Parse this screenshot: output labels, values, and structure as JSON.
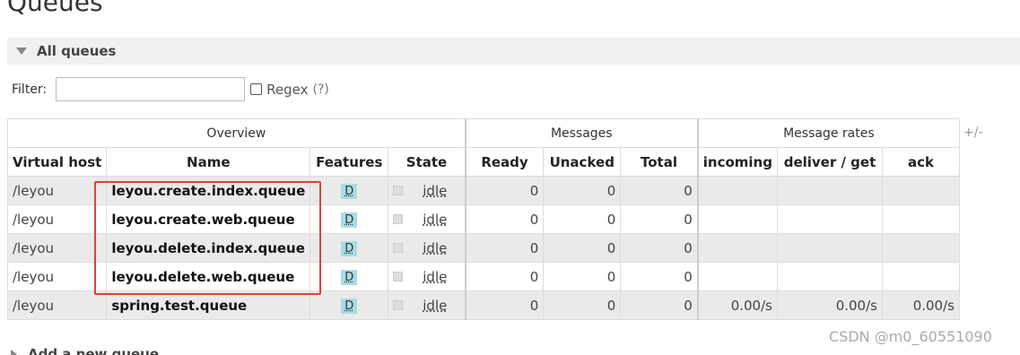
{
  "page": {
    "title": "Queues"
  },
  "section": {
    "title": "All queues"
  },
  "filter": {
    "label": "Filter:",
    "value": "",
    "regex_label": "Regex",
    "regex_help": "(?)"
  },
  "table": {
    "toggle_columns": "+/-",
    "groups": {
      "overview": "Overview",
      "messages": "Messages",
      "rates": "Message rates"
    },
    "headers": {
      "vhost": "Virtual host",
      "name": "Name",
      "features": "Features",
      "state": "State",
      "ready": "Ready",
      "unacked": "Unacked",
      "total": "Total",
      "incoming": "incoming",
      "deliver": "deliver / get",
      "ack": "ack"
    },
    "rows": [
      {
        "vhost": "/leyou",
        "name": "leyou.create.index.queue",
        "feature": "D",
        "state": "idle",
        "ready": "0",
        "unacked": "0",
        "total": "0",
        "incoming": "",
        "deliver": "",
        "ack": ""
      },
      {
        "vhost": "/leyou",
        "name": "leyou.create.web.queue",
        "feature": "D",
        "state": "idle",
        "ready": "0",
        "unacked": "0",
        "total": "0",
        "incoming": "",
        "deliver": "",
        "ack": ""
      },
      {
        "vhost": "/leyou",
        "name": "leyou.delete.index.queue",
        "feature": "D",
        "state": "idle",
        "ready": "0",
        "unacked": "0",
        "total": "0",
        "incoming": "",
        "deliver": "",
        "ack": ""
      },
      {
        "vhost": "/leyou",
        "name": "leyou.delete.web.queue",
        "feature": "D",
        "state": "idle",
        "ready": "0",
        "unacked": "0",
        "total": "0",
        "incoming": "",
        "deliver": "",
        "ack": ""
      },
      {
        "vhost": "/leyou",
        "name": "spring.test.queue",
        "feature": "D",
        "state": "idle",
        "ready": "0",
        "unacked": "0",
        "total": "0",
        "incoming": "0.00/s",
        "deliver": "0.00/s",
        "ack": "0.00/s"
      }
    ]
  },
  "add_section": {
    "title": "Add a new queue"
  },
  "watermark": "CSDN @m0_60551090",
  "colors": {
    "highlight_box": "#d9433b",
    "feature_badge": "#a8dde3",
    "row_alt": "#eaeaea"
  }
}
